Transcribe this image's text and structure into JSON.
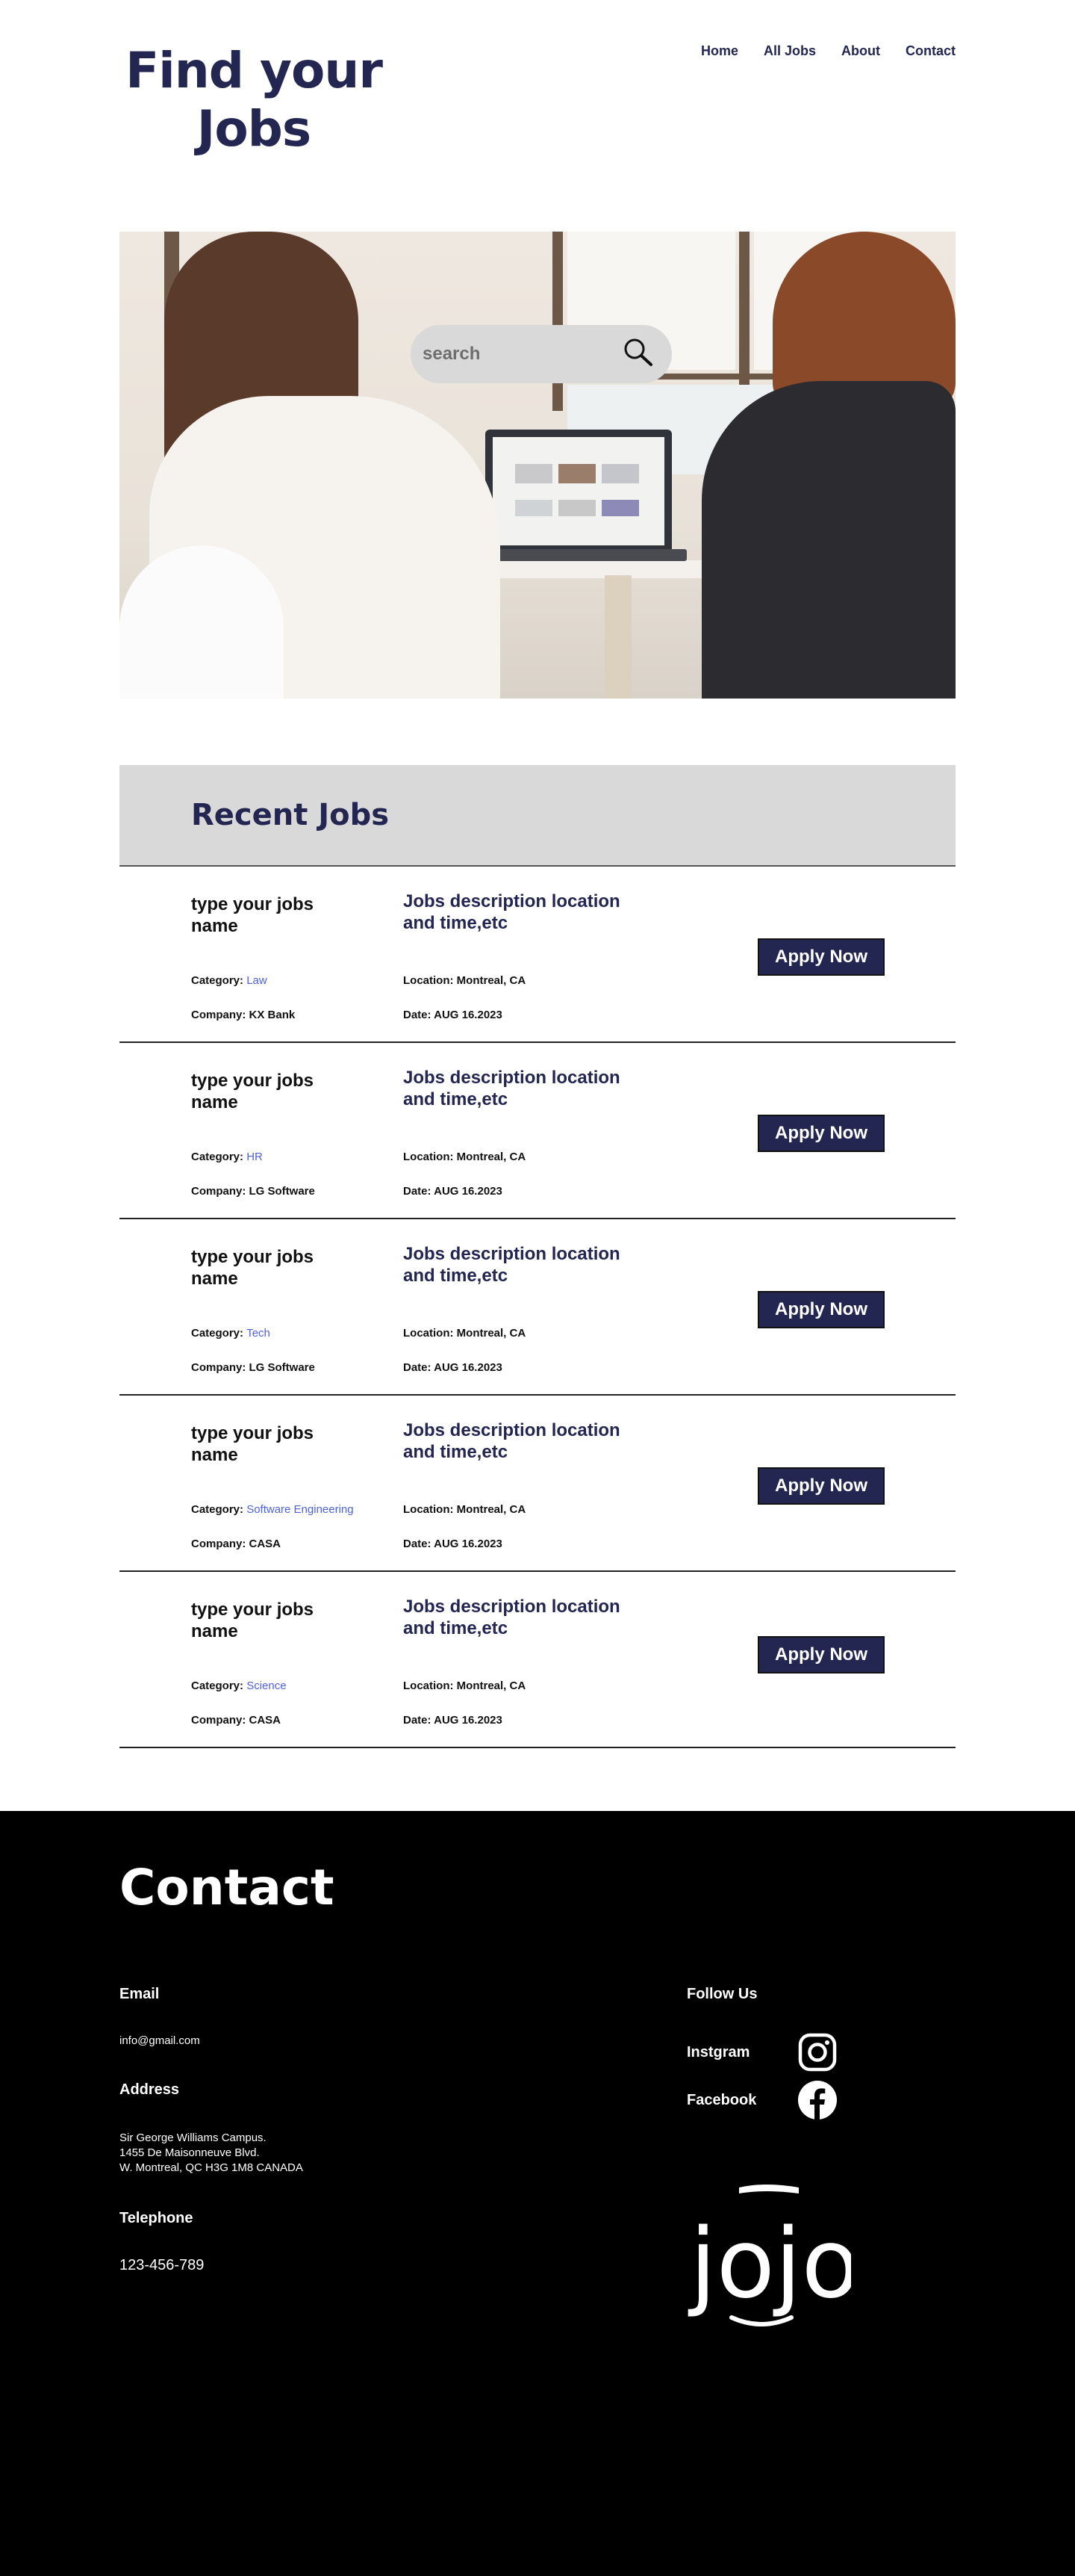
{
  "header": {
    "title": "Find your Jobs",
    "nav": [
      "Home",
      "All Jobs",
      "About",
      "Contact"
    ]
  },
  "hero": {
    "search": {
      "placeholder": "search",
      "icon": "search-icon"
    }
  },
  "recent": {
    "heading": "Recent Jobs",
    "category_label": "Category: ",
    "company_label": "Company: ",
    "location_label": "Location: ",
    "date_label": "Date: ",
    "apply_label": "Apply Now",
    "jobs": [
      {
        "name": "type your jobs name",
        "description": "Jobs description location and time,etc",
        "category": "Law",
        "company": "KX Bank",
        "location": "Montreal, CA",
        "date": "AUG 16.2023"
      },
      {
        "name": "type your jobs name",
        "description": "Jobs description location and time,etc",
        "category": "HR",
        "company": "LG Software",
        "location": "Montreal, CA",
        "date": "AUG 16.2023"
      },
      {
        "name": "type your jobs name",
        "description": "Jobs description location and time,etc",
        "category": "Tech",
        "company": "LG Software",
        "location": "Montreal, CA",
        "date": "AUG 16.2023"
      },
      {
        "name": "type your jobs name",
        "description": "Jobs description location and time,etc",
        "category": "Software Engineering",
        "company": "CASA",
        "location": "Montreal, CA",
        "date": "AUG 16.2023"
      },
      {
        "name": "type your jobs name",
        "description": "Jobs description location and time,etc",
        "category": "Science",
        "company": "CASA",
        "location": "Montreal, CA",
        "date": "AUG 16.2023"
      }
    ]
  },
  "footer": {
    "heading": "Contact",
    "email_label": "Email",
    "email": "info@gmail.com",
    "address_label": "Address",
    "address_lines": [
      "Sir George Williams Campus.",
      "1455 De Maisonneuve Blvd.",
      "W. Montreal, QC H3G 1M8 CANADA"
    ],
    "telephone_label": "Telephone",
    "telephone": "123-456-789",
    "follow_label": "Follow Us",
    "social": [
      {
        "label": "Instgram",
        "icon": "instagram-icon"
      },
      {
        "label": "Facebook",
        "icon": "facebook-icon"
      }
    ],
    "logo_text": "jojo"
  }
}
